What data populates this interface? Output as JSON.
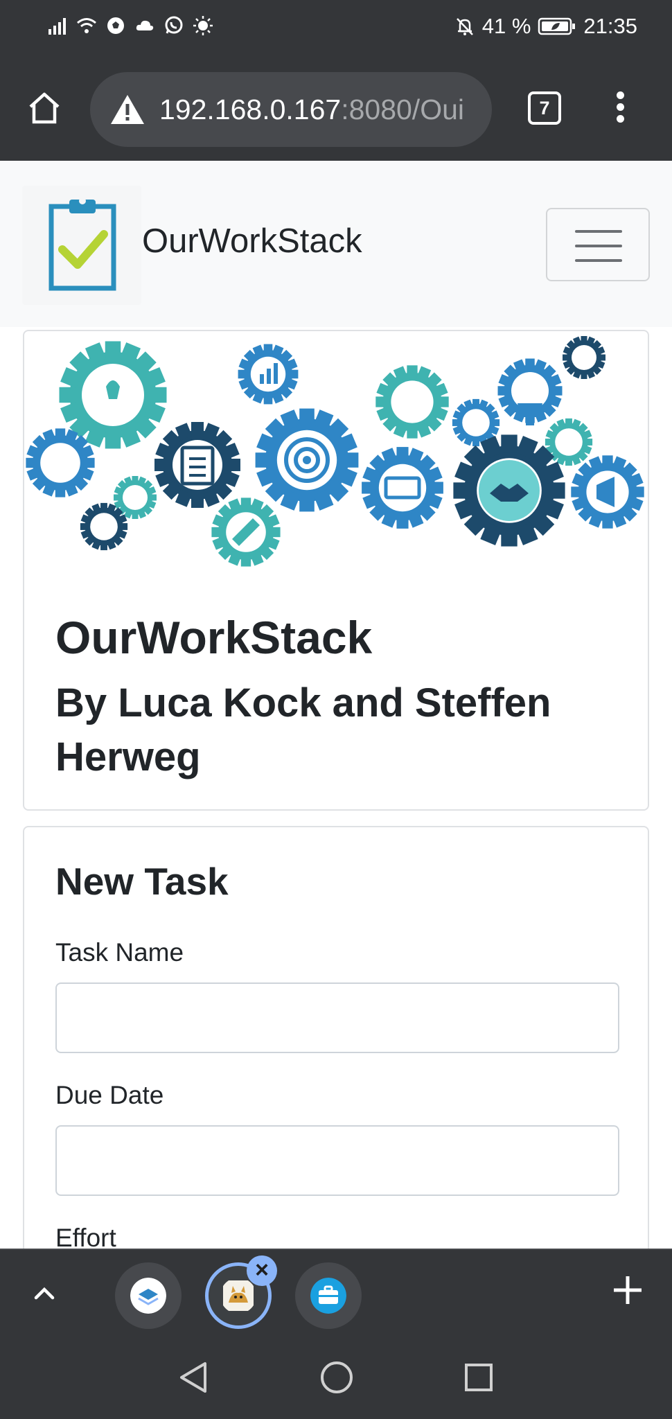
{
  "status_bar": {
    "battery_percent": "41 %",
    "time": "21:35",
    "icons": [
      "signal-icon",
      "wifi-icon",
      "soccer-ball-icon",
      "cloud-icon",
      "whatsapp-icon",
      "brightness-icon",
      "mute-bell-icon",
      "battery-icon"
    ]
  },
  "browser": {
    "url_host": "192.168.0.167",
    "url_path": ":8080/Oui",
    "tab_count": "7"
  },
  "navbar": {
    "brand": "OurWorkStack"
  },
  "hero": {
    "title": "OurWorkStack",
    "subtitle": "By Luca Kock and Steffen Herweg"
  },
  "form": {
    "title": "New Task",
    "fields": [
      {
        "label": "Task Name",
        "value": ""
      },
      {
        "label": "Due Date",
        "value": ""
      },
      {
        "label": "Effort",
        "value": ""
      }
    ]
  },
  "tabstrip": {
    "tab_icons": [
      "stack-app-icon",
      "tomcat-icon",
      "briefcase-icon"
    ]
  },
  "colors": {
    "system_dark": "#343639",
    "gear_teal": "#3fb3b0",
    "gear_navy": "#1d4a6b",
    "gear_blue": "#2f86c6",
    "accent_blue": "#8ab4f8"
  }
}
